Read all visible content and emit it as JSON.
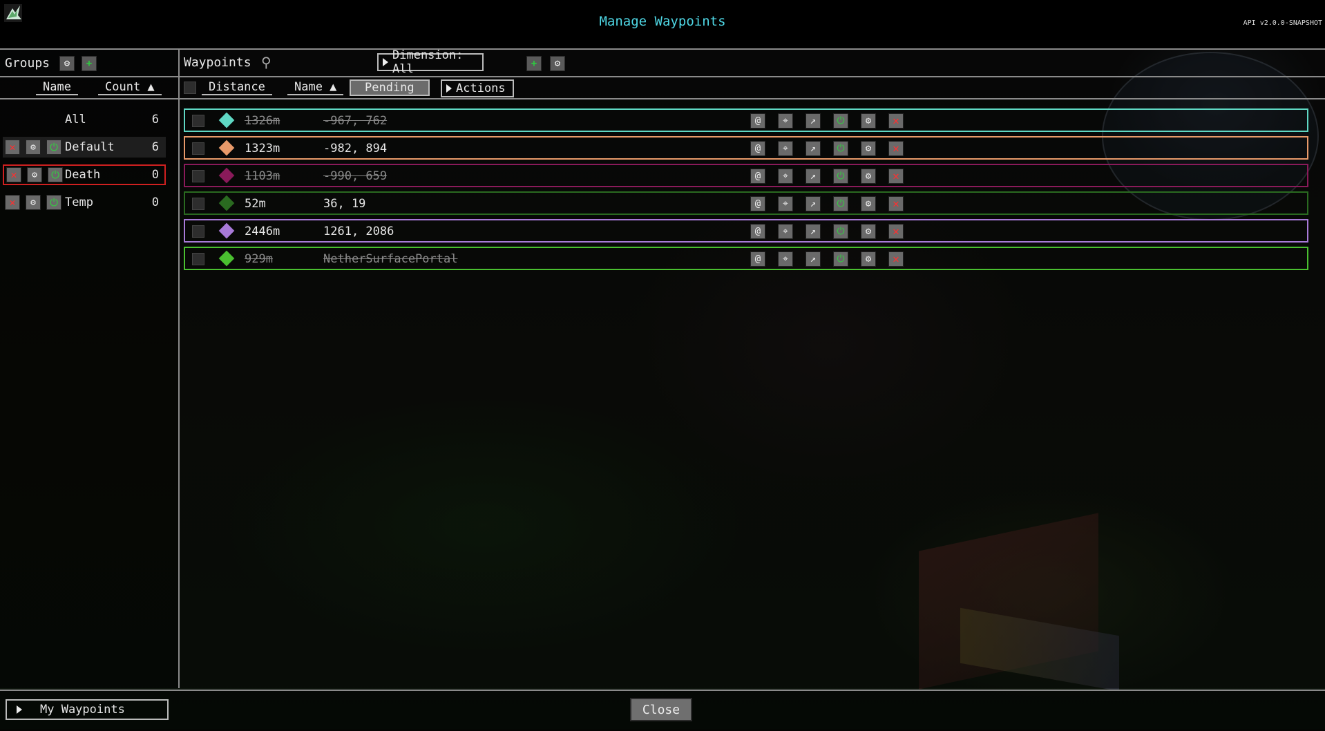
{
  "header": {
    "title": "Manage Waypoints",
    "api_version": "API v2.0.0-SNAPSHOT"
  },
  "groups_panel": {
    "label": "Groups",
    "columns": {
      "name": "Name",
      "count": "Count ▲"
    },
    "items": [
      {
        "name": "All",
        "count": "6"
      },
      {
        "name": "Default",
        "count": "6"
      },
      {
        "name": "Death",
        "count": "0"
      },
      {
        "name": "Temp",
        "count": "0"
      }
    ]
  },
  "waypoints_panel": {
    "label": "Waypoints",
    "dimension_filter": "Dimension: All",
    "columns": {
      "distance": "Distance",
      "name": "Name ▲",
      "pending": "Pending",
      "actions": "Actions"
    },
    "items": [
      {
        "distance": "1326m",
        "name": "-967, 762",
        "color": "#5fd8c4",
        "enabled": false
      },
      {
        "distance": "1323m",
        "name": "-982, 894",
        "color": "#e89a6a",
        "enabled": true
      },
      {
        "distance": "1103m",
        "name": "-990, 659",
        "color": "#8a1a5a",
        "enabled": false
      },
      {
        "distance": "52m",
        "name": "36, 19",
        "color": "#2a6a20",
        "enabled": true
      },
      {
        "distance": "2446m",
        "name": "1261, 2086",
        "color": "#a87ad8",
        "enabled": true
      },
      {
        "distance": "929m",
        "name": "NetherSurfacePortal",
        "color": "#4ac030",
        "enabled": false
      }
    ]
  },
  "footer": {
    "my_waypoints": "My Waypoints",
    "close": "Close"
  },
  "icons": {
    "add": "+",
    "edit": "⚙",
    "delete": "✕",
    "power": "⏻",
    "teleport": "@",
    "locate": "⌖",
    "share": "↗",
    "search": "⚲"
  }
}
